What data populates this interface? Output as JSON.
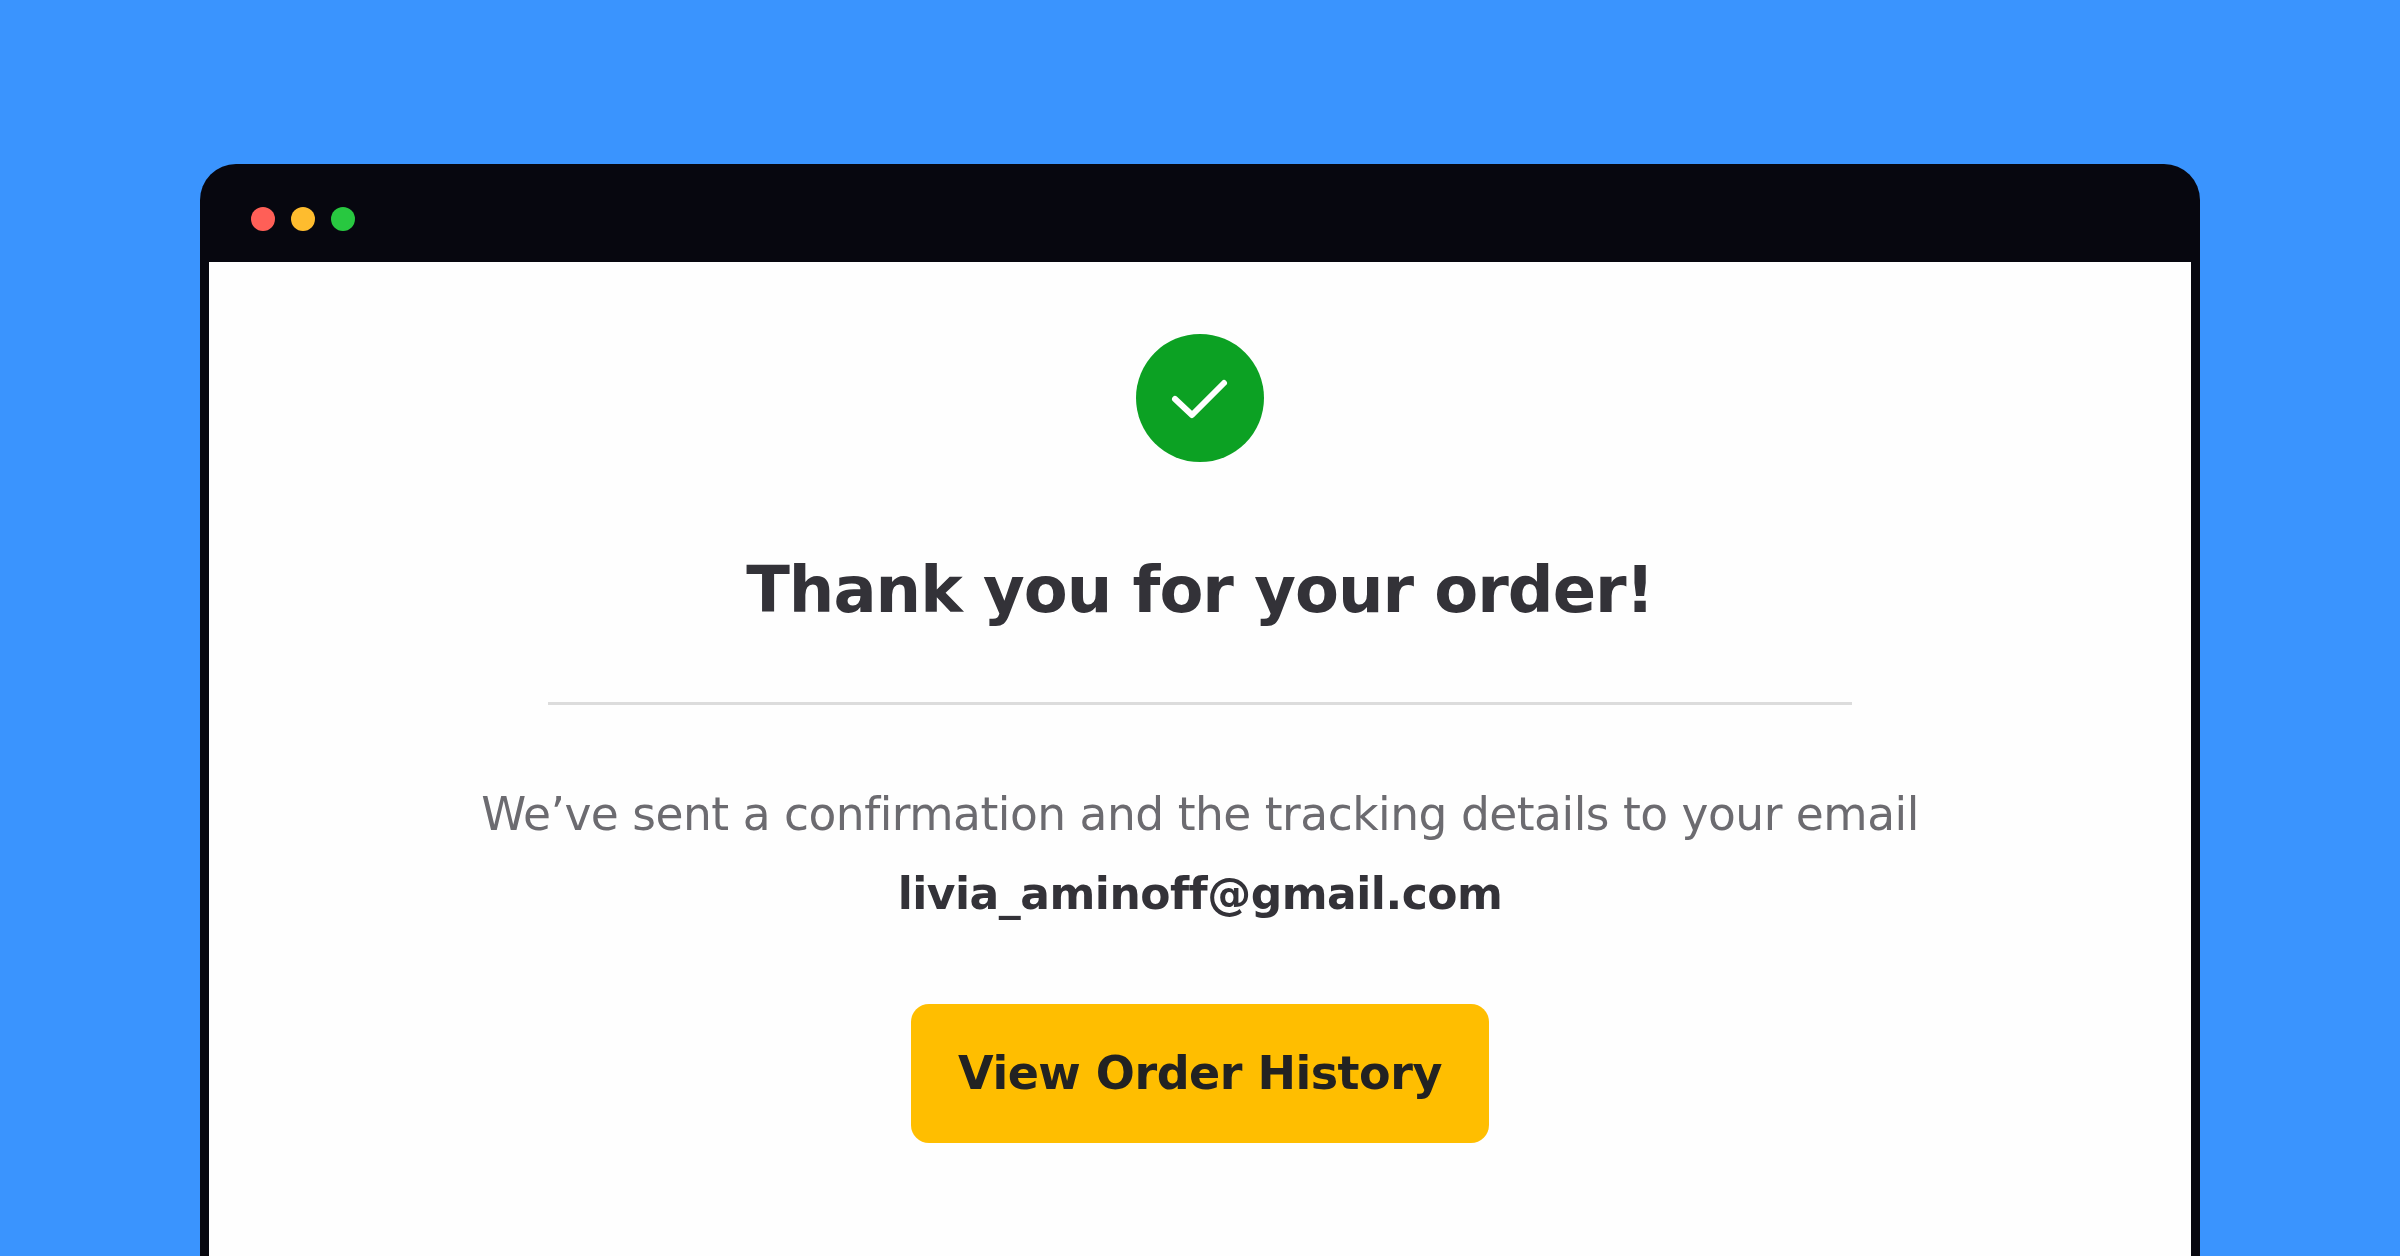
{
  "window": {
    "controls": [
      {
        "color": "#ff5f57"
      },
      {
        "color": "#febc2e"
      },
      {
        "color": "#28c840"
      }
    ]
  },
  "confirmation": {
    "heading": "Thank you for your order!",
    "message": "We’ve sent a confirmation and the tracking details to your email",
    "email": "livia_aminoff@gmail.com",
    "button": "View Order History"
  }
}
